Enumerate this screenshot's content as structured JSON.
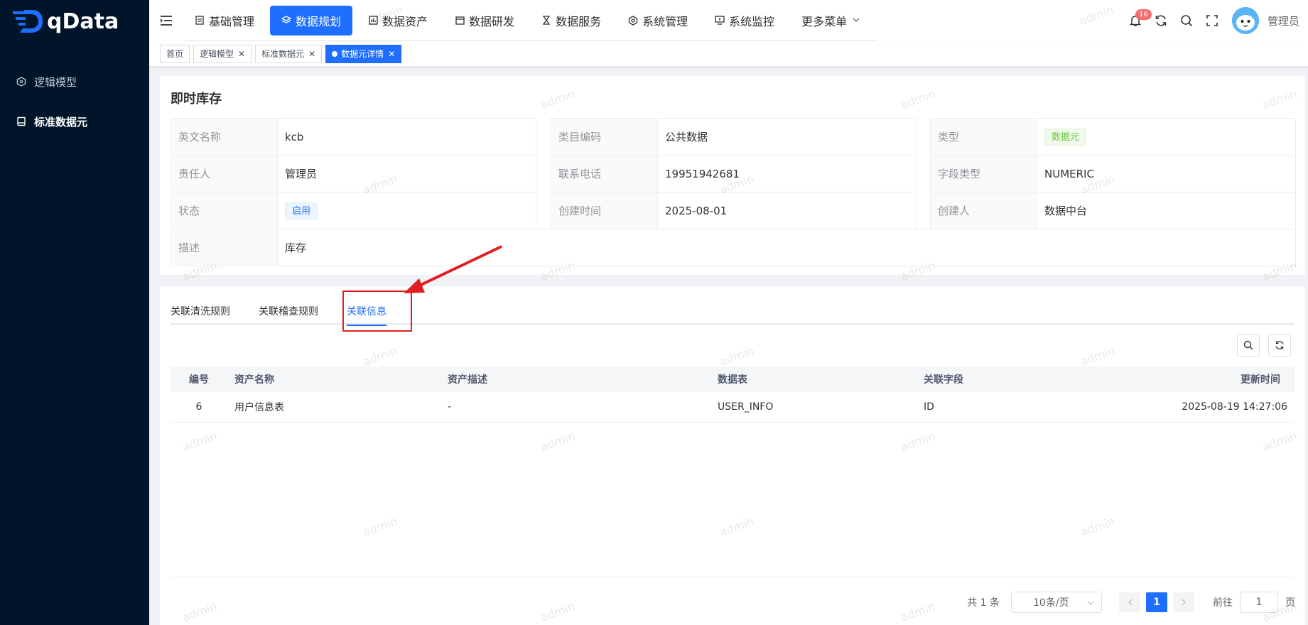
{
  "app": {
    "name": "qData"
  },
  "sidebar": {
    "items": [
      {
        "label": "逻辑模型",
        "icon": "hexagon-icon",
        "active": false
      },
      {
        "label": "标准数据元",
        "icon": "database-icon",
        "active": true
      }
    ]
  },
  "navbar": {
    "items": [
      {
        "label": "基础管理",
        "icon": "doc-icon"
      },
      {
        "label": "数据规划",
        "icon": "layers-icon",
        "active": true
      },
      {
        "label": "数据资产",
        "icon": "chart-icon"
      },
      {
        "label": "数据研发",
        "icon": "window-icon"
      },
      {
        "label": "数据服务",
        "icon": "hourglass-icon"
      },
      {
        "label": "系统管理",
        "icon": "settings-icon"
      },
      {
        "label": "系统监控",
        "icon": "monitor-icon"
      },
      {
        "label": "更多菜单",
        "icon": "chevron-down-icon"
      }
    ],
    "notification_count": "16",
    "user_name": "管理员"
  },
  "tags": [
    {
      "label": "首页",
      "closable": false,
      "active": false
    },
    {
      "label": "逻辑模型",
      "closable": true,
      "active": false
    },
    {
      "label": "标准数据元",
      "closable": true,
      "active": false
    },
    {
      "label": "数据元详情",
      "closable": true,
      "active": true
    }
  ],
  "detail": {
    "title": "即时库存",
    "rows": [
      [
        {
          "label": "英文名称",
          "value": "kcb"
        },
        {
          "label": "类目编码",
          "value": "公共数据"
        },
        {
          "label": "类型",
          "value": "数据元",
          "pill": "green"
        }
      ],
      [
        {
          "label": "责任人",
          "value": "管理员"
        },
        {
          "label": "联系电话",
          "value": "19951942681"
        },
        {
          "label": "字段类型",
          "value": "NUMERIC"
        }
      ],
      [
        {
          "label": "状态",
          "value": "启用",
          "pill": "blue"
        },
        {
          "label": "创建时间",
          "value": "2025-08-01"
        },
        {
          "label": "创建人",
          "value": "数据中台"
        }
      ]
    ],
    "description": {
      "label": "描述",
      "value": "库存"
    }
  },
  "tabs": [
    {
      "label": "关联清洗规则",
      "active": false
    },
    {
      "label": "关联稽查规则",
      "active": false
    },
    {
      "label": "关联信息",
      "active": true
    }
  ],
  "table": {
    "columns": [
      "编号",
      "资产名称",
      "资产描述",
      "数据表",
      "关联字段",
      "更新时间"
    ],
    "rows": [
      [
        "6",
        "用户信息表",
        "-",
        "USER_INFO",
        "ID",
        "2025-08-19 14:27:06"
      ]
    ]
  },
  "pagination": {
    "total": "共 1 条",
    "page_size": "10条/页",
    "current_page": "1",
    "goto_label": "前往",
    "goto_value": "1",
    "page_unit": "页"
  },
  "watermark": "admin",
  "colors": {
    "primary": "#1e6fff",
    "sidebar": "#001529",
    "highlight": "#e02020"
  }
}
